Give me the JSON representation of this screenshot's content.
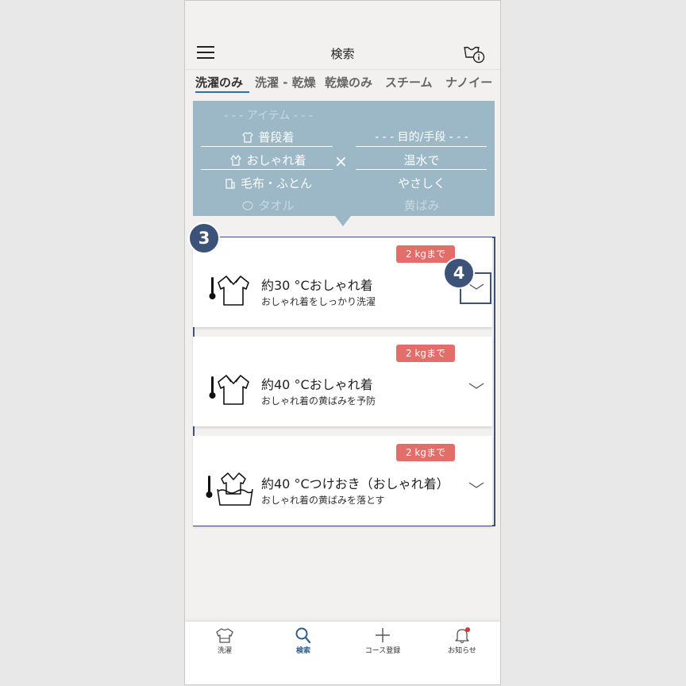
{
  "header": {
    "title": "検索"
  },
  "tabs": [
    {
      "label": "洗濯のみ",
      "active": true
    },
    {
      "label": "洗濯 - 乾燥"
    },
    {
      "label": "乾燥のみ"
    },
    {
      "label": "スチーム"
    },
    {
      "label": "ナノイー"
    }
  ],
  "picker": {
    "item_header": "- - - アイテム - - -",
    "items": [
      {
        "label": "普段着",
        "icon": "tshirt-icon"
      },
      {
        "label": "おしゃれ着",
        "icon": "blouse-icon"
      },
      {
        "label": "毛布・ふとん",
        "icon": "blanket-icon"
      },
      {
        "label": "タオル",
        "icon": "towel-icon"
      }
    ],
    "times": "×",
    "purpose_header": "- - - 目的/手段 - - -",
    "purposes": [
      "温水で",
      "やさしく",
      "黄ばみ"
    ]
  },
  "results": [
    {
      "badge": "2 kgまで",
      "title": "約30 °Cおしゃれ着",
      "subtitle": "おしゃれ着をしっかり洗濯",
      "icon": "thermometer-shirt-icon"
    },
    {
      "badge": "2 kgまで",
      "title": "約40 °Cおしゃれ着",
      "subtitle": "おしゃれ着の黄ばみを予防",
      "icon": "thermometer-shirt-icon"
    },
    {
      "badge": "2 kgまで",
      "title": "約40 °Cつけおき（おしゃれ着）",
      "subtitle": "おしゃれ着の黄ばみを落とす",
      "icon": "thermometer-soak-icon"
    }
  ],
  "annotations": {
    "step3": "3",
    "step4": "4"
  },
  "bottom_nav": [
    {
      "label": "洗濯",
      "icon": "shirt-icon"
    },
    {
      "label": "検索",
      "icon": "search-icon",
      "active": true
    },
    {
      "label": "コース登録",
      "icon": "plus-icon"
    },
    {
      "label": "お知らせ",
      "icon": "bell-icon",
      "notification_dot": true
    }
  ],
  "colors": {
    "accent": "#3d5278",
    "picker_bg": "#9cb8c6",
    "badge": "#e36d68",
    "notification": "#e03030"
  }
}
